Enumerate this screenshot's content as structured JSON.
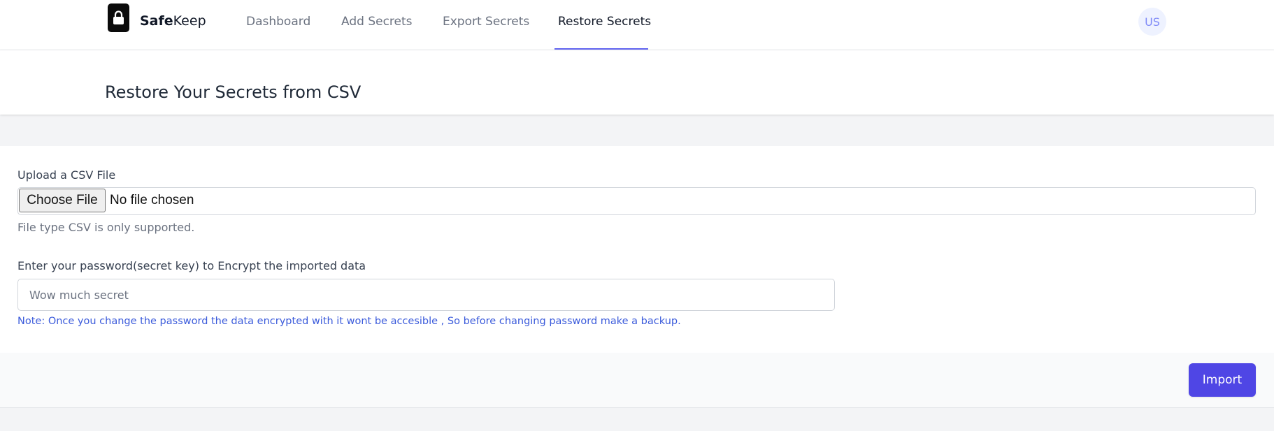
{
  "brand": {
    "name_bold": "Safe",
    "name_rest": "Keep",
    "icon": "lock-icon"
  },
  "nav": {
    "items": [
      {
        "label": "Dashboard",
        "active": false
      },
      {
        "label": "Add Secrets",
        "active": false
      },
      {
        "label": "Export Secrets",
        "active": false
      },
      {
        "label": "Restore Secrets",
        "active": true
      }
    ],
    "avatar_initials": "US"
  },
  "header": {
    "title": "Restore Your Secrets from CSV"
  },
  "form": {
    "file_label": "Upload a CSV File",
    "choose_button": "Choose File",
    "file_status": "No file chosen",
    "file_help": "File type CSV is only supported.",
    "password_label": "Enter your password(secret key) to Encrypt the imported data",
    "password_placeholder": "Wow much secret",
    "password_value": "",
    "note": "Note: Once you change the password the data encrypted with it wont be accesible , So before changing password make a backup."
  },
  "actions": {
    "import_label": "Import"
  },
  "colors": {
    "accent": "#4f46e5",
    "active_underline": "#6366f1",
    "note_text": "#3b5bdb",
    "avatar_bg": "#eef2ff"
  }
}
